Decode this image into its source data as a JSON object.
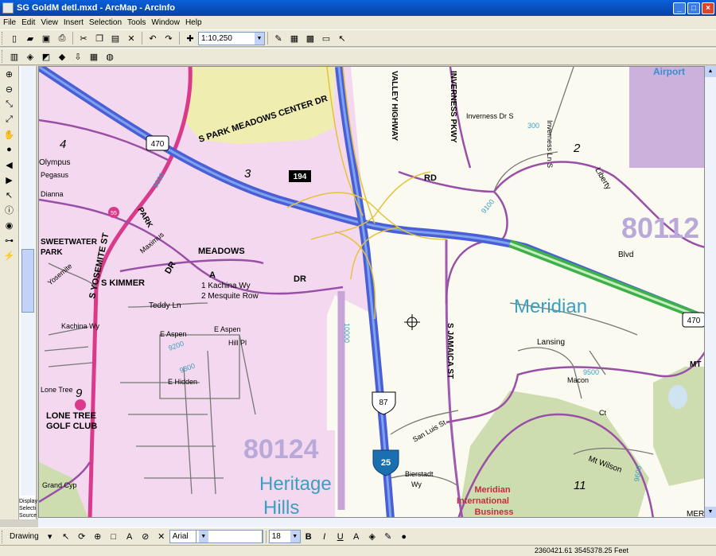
{
  "window": {
    "title": "SG GoldM detl.mxd - ArcMap - ArcInfo"
  },
  "menu": [
    "File",
    "Edit",
    "View",
    "Insert",
    "Selection",
    "Tools",
    "Window",
    "Help"
  ],
  "toolbar": {
    "scale": "1:10,250"
  },
  "toc_tabs": [
    "Display",
    "Selecti",
    "Source"
  ],
  "drawing": {
    "label": "Drawing",
    "font": "Arial",
    "size": "18"
  },
  "status": {
    "coords": "2360421.61  3545378.25 Feet"
  },
  "map": {
    "places": {
      "airport": "Airport",
      "zip_80112": "80112",
      "meridian": "Meridian",
      "zip_80124": "80124",
      "heritage": "Heritage",
      "hills": "Hills",
      "sweetwater1": "SWEETWATER",
      "sweetwater2": "PARK",
      "lonetree1": "LONE TREE",
      "lonetree2": "GOLF CLUB",
      "mib1": "Meridian",
      "mib2": "International",
      "mib3": "Business"
    },
    "grid": {
      "g2": "2",
      "g3": "3",
      "g4": "4",
      "g9": "9",
      "g11": "11"
    },
    "shields": {
      "i470a": "470",
      "i470b": "470",
      "r194": "194",
      "us87": "87",
      "i25": "25",
      "c55": "55"
    },
    "streets": {
      "park_meadows_center": "S PARK MEADOWS CENTER DR",
      "valley_highway": "VALLEY HIGHWAY",
      "inverness_pkwy": "INVERNESS PKWY",
      "inverness_dr": "Inverness Dr S",
      "inverness_ln": "Inverness Ln S",
      "rd": "RD",
      "liberty": "Liberty",
      "blvd": "Blvd",
      "yosemite": "S YOSEMITE ST",
      "park": "PARK",
      "maximus": "Maximus",
      "meadows": "MEADOWS",
      "dr1": "DR",
      "dr2": "DR",
      "kimmer": "S KIMMER",
      "olympus": "Olympus",
      "pegasus": "Pegasus",
      "dianna": "Dianna",
      "legend_a": "A",
      "legend_1": "1  Kachina Wy",
      "legend_2": "2  Mesquite Row",
      "teddy": "Teddy Ln",
      "aspen1": "E Aspen",
      "aspen2": "E Aspen",
      "hill_pl": "Hill Pl",
      "hidden": "E Hidden",
      "jamaica": "S JAMAICA ST",
      "lansing": "Lansing",
      "macon": "Macon",
      "ct": "Ct",
      "mt_wilson": "Mt Wilson",
      "san_luis": "San Luis St",
      "bierstadt": "Bierstadt",
      "wy": "Wy",
      "lone_tree": "Lone Tree",
      "grand_cyp": "Grand Cyp",
      "kachina": "Kachina Wy",
      "yosemite_w": "Yosemite",
      "mt": "MT",
      "mer": "MER"
    },
    "numbers": {
      "n300": "300",
      "n9100": "9100",
      "n8600": "8600",
      "n9200": "9200",
      "n9300": "9300",
      "n9500": "9500",
      "n9600": "9600",
      "n10000": "10000"
    }
  }
}
